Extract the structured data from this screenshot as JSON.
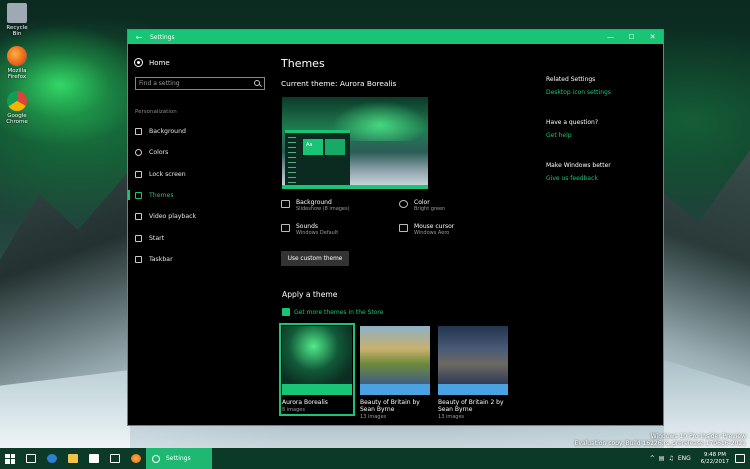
{
  "desktop": {
    "icons": [
      {
        "label": "Recycle Bin",
        "name": "recycle-bin",
        "color": "#9ea9b3"
      },
      {
        "label": "Mozilla Firefox",
        "name": "firefox",
        "color": "#e8621d"
      },
      {
        "label": "Google Chrome",
        "name": "chrome",
        "color": "#3a8ee6"
      }
    ],
    "watermark": {
      "line1": "Windows 10 Pro Insider Preview",
      "line2": "Evaluation copy. Build 16226.rs_prerelease.170616-2021"
    }
  },
  "window": {
    "title": "Settings",
    "back_icon": "arrow-left-icon",
    "controls": {
      "minimize": "—",
      "maximize": "☐",
      "close": "✕"
    },
    "accent": "#19c477"
  },
  "sidebar": {
    "home": "Home",
    "search_placeholder": "Find a setting",
    "section_label": "Personalization",
    "items": [
      {
        "label": "Background",
        "icon": "picture-icon"
      },
      {
        "label": "Colors",
        "icon": "palette-icon"
      },
      {
        "label": "Lock screen",
        "icon": "monitor-icon"
      },
      {
        "label": "Themes",
        "icon": "brush-icon",
        "active": true
      },
      {
        "label": "Video playback",
        "icon": "video-icon"
      },
      {
        "label": "Start",
        "icon": "start-icon"
      },
      {
        "label": "Taskbar",
        "icon": "taskbar-icon"
      }
    ]
  },
  "main": {
    "title": "Themes",
    "current_theme": "Current theme: Aurora Borealis",
    "preview_sample_text": "Aa",
    "properties": [
      {
        "name": "Background",
        "value": "Slideshow (8 images)",
        "icon": "picture-icon"
      },
      {
        "name": "Color",
        "value": "Bright green",
        "icon": "palette-icon"
      },
      {
        "name": "Sounds",
        "value": "Windows Default",
        "icon": "speaker-icon"
      },
      {
        "name": "Mouse cursor",
        "value": "Windows Aero",
        "icon": "cursor-icon"
      }
    ],
    "custom_button": "Use custom theme",
    "apply_heading": "Apply a theme",
    "store_link": "Get more themes in the Store",
    "themes": [
      {
        "name": "Aurora Borealis",
        "count": "8 images",
        "strip_color": "#19c477",
        "selected": true
      },
      {
        "name": "Beauty of Britain by Sean Byrne",
        "count": "13 images",
        "strip_color": "#4aa3e0",
        "selected": false
      },
      {
        "name": "Beauty of Britain 2 by Sean Byrne",
        "count": "13 images",
        "strip_color": "#4aa3e0",
        "selected": false
      }
    ]
  },
  "right_panel": {
    "related_heading": "Related Settings",
    "related_link": "Desktop icon settings",
    "question_heading": "Have a question?",
    "question_link": "Get help",
    "better_heading": "Make Windows better",
    "better_link": "Give us feedback"
  },
  "taskbar": {
    "active_app": "Settings",
    "time": "9:48 PM",
    "date": "6/22/2017",
    "lang": "ENG"
  }
}
